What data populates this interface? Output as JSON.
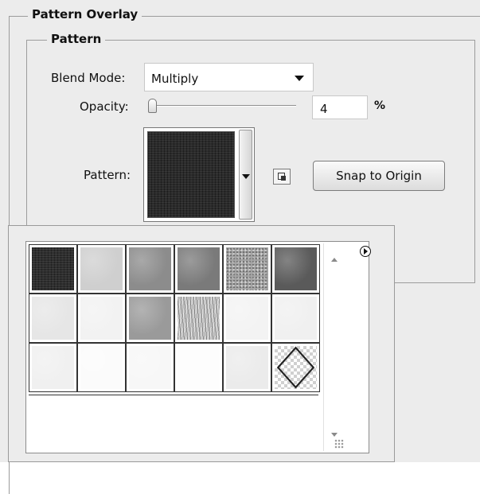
{
  "outer_section": {
    "title": "Pattern Overlay"
  },
  "inner_section": {
    "title": "Pattern"
  },
  "blend_mode": {
    "label": "Blend Mode:",
    "value": "Multiply"
  },
  "opacity": {
    "label": "Opacity:",
    "value": "4",
    "unit": "%",
    "slider_fraction": 0.04
  },
  "pattern": {
    "label": "Pattern:",
    "selected_swatch": "dark-fabric"
  },
  "buttons": {
    "snap_to_origin": "Snap to Origin",
    "new_preset_icon": "new-preset-icon"
  },
  "popup": {
    "menu_icon": "panel-menu-arrow-icon",
    "swatches": [
      {
        "name": "swatch-dark-fabric",
        "color": "#2e2e2e",
        "texture": "dark"
      },
      {
        "name": "swatch-light-gray",
        "color": "#cfcfcf",
        "texture": "soft"
      },
      {
        "name": "swatch-mid-gray-1",
        "color": "#8c8c8c",
        "texture": "soft"
      },
      {
        "name": "swatch-mid-gray-2",
        "color": "#7a7a7a",
        "texture": "soft"
      },
      {
        "name": "swatch-granite",
        "color": "#a6a6a6",
        "texture": "noise"
      },
      {
        "name": "swatch-dark-gray",
        "color": "#5a5a5a",
        "texture": "soft"
      },
      {
        "name": "swatch-pale-1",
        "color": "#e6e6e6",
        "texture": "soft"
      },
      {
        "name": "swatch-pale-2",
        "color": "#f2f2f2",
        "texture": "soft"
      },
      {
        "name": "swatch-mid-gray-3",
        "color": "#9a9a9a",
        "texture": "soft"
      },
      {
        "name": "swatch-wood-grain",
        "color": "#bdbdbd",
        "texture": "grain"
      },
      {
        "name": "swatch-pale-3",
        "color": "#f3f3f3",
        "texture": "soft"
      },
      {
        "name": "swatch-pale-4",
        "color": "#f0f0f0",
        "texture": "soft"
      },
      {
        "name": "swatch-pale-5",
        "color": "#f0f0f0",
        "texture": "soft"
      },
      {
        "name": "swatch-white-1",
        "color": "#fbfbfb",
        "texture": "soft"
      },
      {
        "name": "swatch-white-2",
        "color": "#f7f7f7",
        "texture": "soft"
      },
      {
        "name": "swatch-white-3",
        "color": "#fdfdfd",
        "texture": "soft"
      },
      {
        "name": "swatch-pale-6",
        "color": "#ebebeb",
        "texture": "soft"
      },
      {
        "name": "swatch-transparent-diamond",
        "color": "#ffffff",
        "texture": "checker"
      }
    ]
  }
}
